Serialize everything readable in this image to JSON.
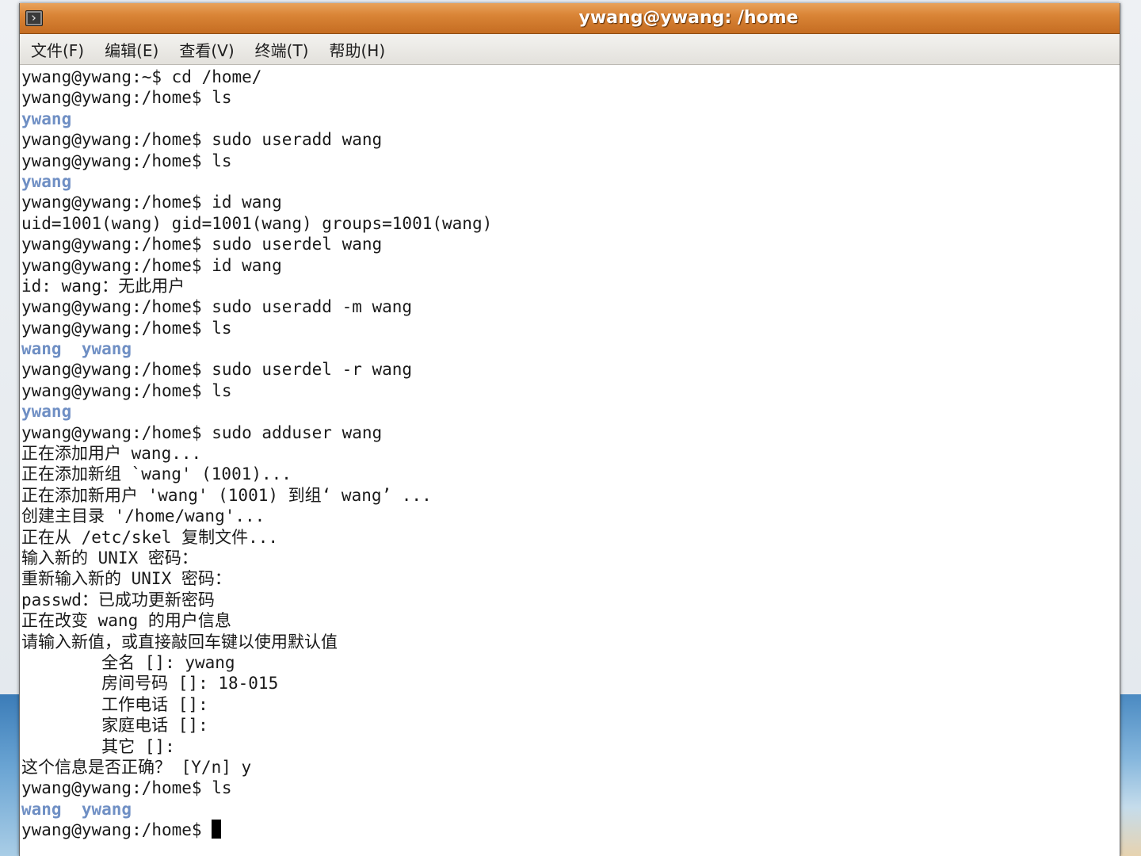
{
  "window": {
    "title": "ywang@ywang: /home"
  },
  "menu": [
    "文件(F)",
    "编辑(E)",
    "查看(V)",
    "终端(T)",
    "帮助(H)"
  ],
  "terminal": {
    "lines": [
      {
        "text": "ywang@ywang:~$ cd /home/",
        "type": "cmd"
      },
      {
        "text": "ywang@ywang:/home$ ls",
        "type": "cmd"
      },
      {
        "text": "ywang",
        "type": "dir"
      },
      {
        "text": "ywang@ywang:/home$ sudo useradd wang",
        "type": "cmd"
      },
      {
        "text": "ywang@ywang:/home$ ls",
        "type": "cmd"
      },
      {
        "text": "ywang",
        "type": "dir"
      },
      {
        "text": "ywang@ywang:/home$ id wang",
        "type": "cmd"
      },
      {
        "text": "uid=1001(wang) gid=1001(wang) groups=1001(wang)",
        "type": "out"
      },
      {
        "text": "ywang@ywang:/home$ sudo userdel wang",
        "type": "cmd"
      },
      {
        "text": "ywang@ywang:/home$ id wang",
        "type": "cmd"
      },
      {
        "text": "id: wang：无此用户",
        "type": "out"
      },
      {
        "text": "ywang@ywang:/home$ sudo useradd -m wang",
        "type": "cmd"
      },
      {
        "text": "ywang@ywang:/home$ ls",
        "type": "cmd"
      },
      {
        "text": "wang  ywang",
        "type": "dir"
      },
      {
        "text": "ywang@ywang:/home$ sudo userdel -r wang",
        "type": "cmd"
      },
      {
        "text": "ywang@ywang:/home$ ls",
        "type": "cmd"
      },
      {
        "text": "ywang",
        "type": "dir"
      },
      {
        "text": "ywang@ywang:/home$ sudo adduser wang",
        "type": "cmd"
      },
      {
        "text": "正在添加用户 wang...",
        "type": "out"
      },
      {
        "text": "正在添加新组 `wang' (1001)...",
        "type": "out"
      },
      {
        "text": "正在添加新用户 'wang' (1001) 到组‘ wang’ ...",
        "type": "out"
      },
      {
        "text": "创建主目录 '/home/wang'...",
        "type": "out"
      },
      {
        "text": "正在从 /etc/skel 复制文件...",
        "type": "out"
      },
      {
        "text": "输入新的 UNIX 密码：",
        "type": "out"
      },
      {
        "text": "重新输入新的 UNIX 密码：",
        "type": "out"
      },
      {
        "text": "passwd：已成功更新密码",
        "type": "out"
      },
      {
        "text": "正在改变 wang 的用户信息",
        "type": "out"
      },
      {
        "text": "请输入新值，或直接敲回车键以使用默认值",
        "type": "out"
      },
      {
        "text": "\t全名 []: ywang",
        "type": "out"
      },
      {
        "text": "\t房间号码 []: 18-015",
        "type": "out"
      },
      {
        "text": "\t工作电话 []:",
        "type": "out"
      },
      {
        "text": "\t家庭电话 []:",
        "type": "out"
      },
      {
        "text": "\t其它 []:",
        "type": "out"
      },
      {
        "text": "这个信息是否正确？ [Y/n] y",
        "type": "out"
      },
      {
        "text": "ywang@ywang:/home$ ls",
        "type": "cmd"
      },
      {
        "text": "wang  ywang",
        "type": "dir"
      },
      {
        "text": "ywang@ywang:/home$ ",
        "type": "prompt"
      }
    ],
    "colors": {
      "dir": "#6f8fc4",
      "text": "#1a1a1a"
    }
  }
}
